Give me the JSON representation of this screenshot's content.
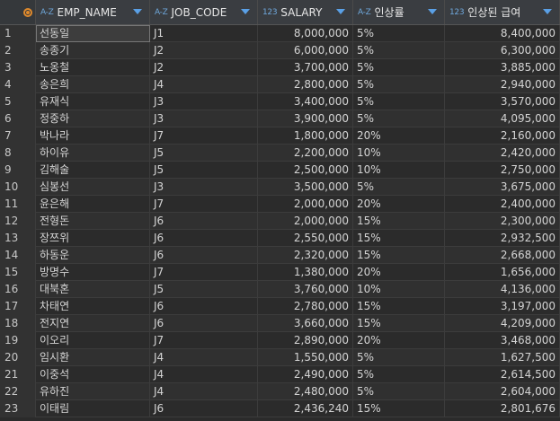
{
  "columns": [
    {
      "type_icon": "A-Z",
      "label": "EMP_NAME"
    },
    {
      "type_icon": "A-Z",
      "label": "JOB_CODE"
    },
    {
      "type_icon": "123",
      "label": "SALARY"
    },
    {
      "type_icon": "A-Z",
      "label": "인상률"
    },
    {
      "type_icon": "123",
      "label": "인상된 급여"
    }
  ],
  "rows": [
    {
      "n": "1",
      "name": "선동일",
      "job": "J1",
      "salary": "8,000,000",
      "rate": "5%",
      "raised": "8,400,000"
    },
    {
      "n": "2",
      "name": "송종기",
      "job": "J2",
      "salary": "6,000,000",
      "rate": "5%",
      "raised": "6,300,000"
    },
    {
      "n": "3",
      "name": "노옹철",
      "job": "J2",
      "salary": "3,700,000",
      "rate": "5%",
      "raised": "3,885,000"
    },
    {
      "n": "4",
      "name": "송은희",
      "job": "J4",
      "salary": "2,800,000",
      "rate": "5%",
      "raised": "2,940,000"
    },
    {
      "n": "5",
      "name": "유재식",
      "job": "J3",
      "salary": "3,400,000",
      "rate": "5%",
      "raised": "3,570,000"
    },
    {
      "n": "6",
      "name": "정중하",
      "job": "J3",
      "salary": "3,900,000",
      "rate": "5%",
      "raised": "4,095,000"
    },
    {
      "n": "7",
      "name": "박나라",
      "job": "J7",
      "salary": "1,800,000",
      "rate": "20%",
      "raised": "2,160,000"
    },
    {
      "n": "8",
      "name": "하이유",
      "job": "J5",
      "salary": "2,200,000",
      "rate": "10%",
      "raised": "2,420,000"
    },
    {
      "n": "9",
      "name": "김해술",
      "job": "J5",
      "salary": "2,500,000",
      "rate": "10%",
      "raised": "2,750,000"
    },
    {
      "n": "10",
      "name": "심봉선",
      "job": "J3",
      "salary": "3,500,000",
      "rate": "5%",
      "raised": "3,675,000"
    },
    {
      "n": "11",
      "name": "윤은해",
      "job": "J7",
      "salary": "2,000,000",
      "rate": "20%",
      "raised": "2,400,000"
    },
    {
      "n": "12",
      "name": "전형돈",
      "job": "J6",
      "salary": "2,000,000",
      "rate": "15%",
      "raised": "2,300,000"
    },
    {
      "n": "13",
      "name": "장쯔위",
      "job": "J6",
      "salary": "2,550,000",
      "rate": "15%",
      "raised": "2,932,500"
    },
    {
      "n": "14",
      "name": "하동운",
      "job": "J6",
      "salary": "2,320,000",
      "rate": "15%",
      "raised": "2,668,000"
    },
    {
      "n": "15",
      "name": "방명수",
      "job": "J7",
      "salary": "1,380,000",
      "rate": "20%",
      "raised": "1,656,000"
    },
    {
      "n": "16",
      "name": "대북혼",
      "job": "J5",
      "salary": "3,760,000",
      "rate": "10%",
      "raised": "4,136,000"
    },
    {
      "n": "17",
      "name": "차태연",
      "job": "J6",
      "salary": "2,780,000",
      "rate": "15%",
      "raised": "3,197,000"
    },
    {
      "n": "18",
      "name": "전지연",
      "job": "J6",
      "salary": "3,660,000",
      "rate": "15%",
      "raised": "4,209,000"
    },
    {
      "n": "19",
      "name": "이오리",
      "job": "J7",
      "salary": "2,890,000",
      "rate": "20%",
      "raised": "3,468,000"
    },
    {
      "n": "20",
      "name": "임시환",
      "job": "J4",
      "salary": "1,550,000",
      "rate": "5%",
      "raised": "1,627,500"
    },
    {
      "n": "21",
      "name": "이중석",
      "job": "J4",
      "salary": "2,490,000",
      "rate": "5%",
      "raised": "2,614,500"
    },
    {
      "n": "22",
      "name": "유하진",
      "job": "J4",
      "salary": "2,480,000",
      "rate": "5%",
      "raised": "2,604,000"
    },
    {
      "n": "23",
      "name": "이태림",
      "job": "J6",
      "salary": "2,436,240",
      "rate": "15%",
      "raised": "2,801,676"
    }
  ]
}
